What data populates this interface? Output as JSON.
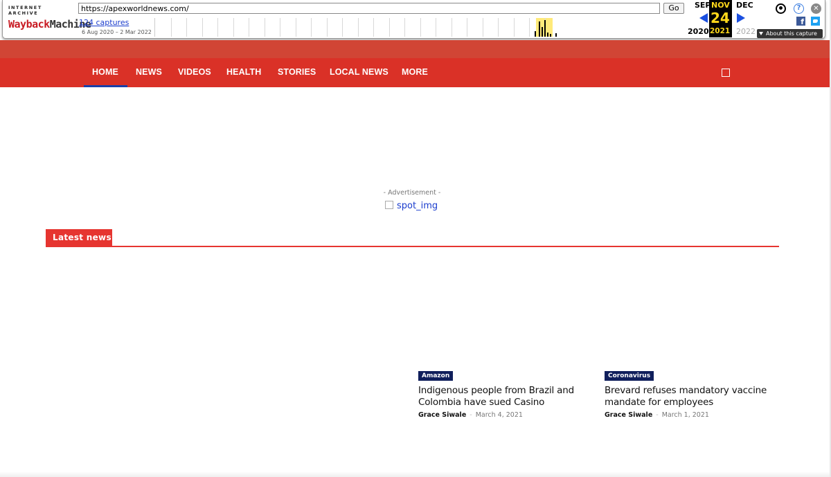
{
  "wayback": {
    "logo_top": "INTERNET ARCHIVE",
    "logo_way": "Wayback",
    "logo_machine": "Machine",
    "url": "https://apexworldnews.com/",
    "go_label": "Go",
    "captures": "124 captures",
    "range": "6 Aug 2020 – 2 Mar 2022",
    "prev_month": "SEP",
    "cur_month": "NOV",
    "next_month": "DEC",
    "cur_day": "24",
    "prev_year": "2020",
    "cur_year": "2021",
    "next_year": "2022",
    "about": "About this capture",
    "help_glyph": "?",
    "close_glyph": "✕",
    "fb_glyph": "f"
  },
  "nav": {
    "items": [
      "HOME",
      "NEWS",
      "VIDEOS",
      "HEALTH",
      "STORIES",
      "LOCAL NEWS",
      "MORE"
    ]
  },
  "ad": {
    "label": "- Advertisement -",
    "img_alt": "spot_img"
  },
  "latest": {
    "heading": "Latest news",
    "articles": [
      {
        "tag": "Amazon",
        "title": "Indigenous people from Brazil and Colombia have sued Casino",
        "author": "Grace Siwale",
        "sep": "-",
        "date": "March 4, 2021"
      },
      {
        "tag": "Coronavirus",
        "title": "Brevard refuses mandatory vaccine mandate for employees",
        "author": "Grace Siwale",
        "sep": "-",
        "date": "March 1, 2021"
      }
    ]
  },
  "colors": {
    "nav_red": "#da3127",
    "accent_red": "#e63530",
    "tag_navy": "#101f5c"
  }
}
